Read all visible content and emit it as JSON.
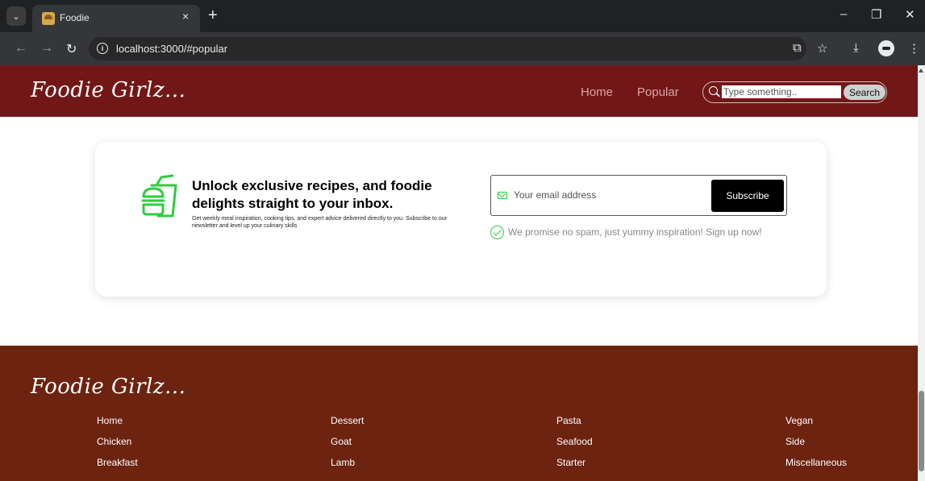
{
  "browser": {
    "tab_title": "Foodie",
    "url": "localhost:3000/#popular",
    "tab_close": "×",
    "new_tab": "+",
    "minimize": "–",
    "restore": "❐",
    "close": "✕"
  },
  "header": {
    "logo": "Foodie Girlz...",
    "nav": [
      "Home",
      "Popular"
    ],
    "search_placeholder": "Type something..",
    "search_button": "Search"
  },
  "newsletter": {
    "headline": "Unlock exclusive recipes, and foodie delights straight to your inbox.",
    "subtext": "Get weekly meal inspiration, cooking tips, and expert advice delivered directly to you. Subscribe to our newsletter and level up your culinary skills",
    "email_placeholder": "Your email address",
    "subscribe_button": "Subscribe",
    "promise": "We promise no spam, just yummy inspiration! Sign up now!"
  },
  "footer": {
    "logo": "Foodie Girlz...",
    "columns": [
      [
        "Home",
        "Chicken",
        "Breakfast"
      ],
      [
        "Dessert",
        "Goat",
        "Lamb"
      ],
      [
        "Pasta",
        "Seafood",
        "Starter"
      ],
      [
        "Vegan",
        "Side",
        "Miscellaneous"
      ]
    ]
  },
  "colors": {
    "header_bg": "#721717",
    "footer_bg": "#6c2310",
    "accent_green": "#2ecc40",
    "subscribe_bg": "#000000"
  }
}
